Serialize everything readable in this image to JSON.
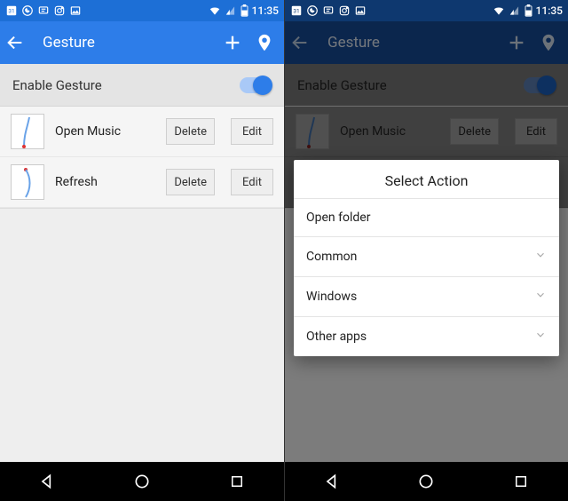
{
  "status": {
    "time": "11:35"
  },
  "appbar": {
    "title": "Gesture"
  },
  "toggle": {
    "label": "Enable Gesture",
    "on": true
  },
  "gestures": [
    {
      "label": "Open Music",
      "delete": "Delete",
      "edit": "Edit"
    },
    {
      "label": "Refresh",
      "delete": "Delete",
      "edit": "Edit"
    }
  ],
  "dialog": {
    "title": "Select Action",
    "items": [
      {
        "label": "Open folder",
        "expandable": false
      },
      {
        "label": "Common",
        "expandable": true
      },
      {
        "label": "Windows",
        "expandable": true
      },
      {
        "label": "Other apps",
        "expandable": true
      }
    ]
  }
}
